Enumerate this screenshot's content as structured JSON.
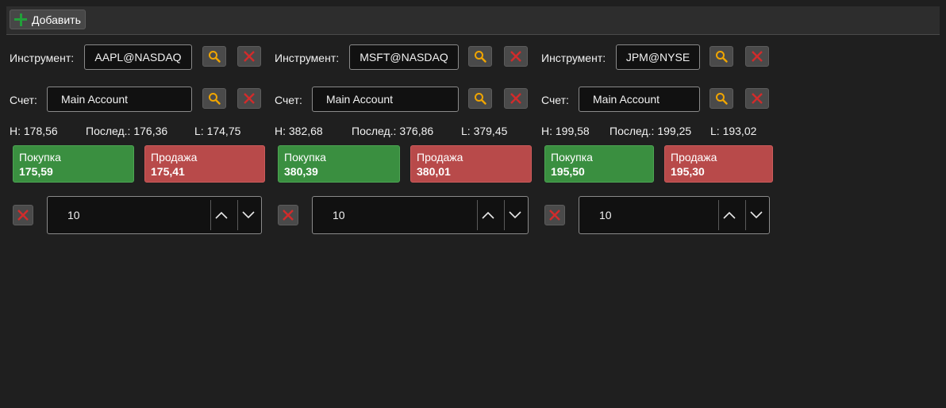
{
  "toolbar": {
    "add_label": "Добавить"
  },
  "colors": {
    "buy": "#3a8f40",
    "sell": "#b84a4a",
    "search_icon": "#f0a500",
    "close_icon": "#d22b2b",
    "add_icon": "#22a03a"
  },
  "panels": [
    {
      "instrument_label": "Инструмент:",
      "instrument": "AAPL@NASDAQ",
      "account_label": "Счет:",
      "account": "Main Account",
      "high": "H: 178,56",
      "last": "Послед.: 176,36",
      "low": "L: 174,75",
      "buy_label": "Покупка",
      "buy_price": "175,59",
      "sell_label": "Продажа",
      "sell_price": "175,41",
      "quantity": "10"
    },
    {
      "instrument_label": "Инструмент:",
      "instrument": "MSFT@NASDAQ",
      "account_label": "Счет:",
      "account": "Main Account",
      "high": "H: 382,68",
      "last": "Послед.: 376,86",
      "low": "L: 379,45",
      "buy_label": "Покупка",
      "buy_price": "380,39",
      "sell_label": "Продажа",
      "sell_price": "380,01",
      "quantity": "10"
    },
    {
      "instrument_label": "Инструмент:",
      "instrument": "JPM@NYSE",
      "account_label": "Счет:",
      "account": "Main Account",
      "high": "H: 199,58",
      "last": "Послед.: 199,25",
      "low": "L: 193,02",
      "buy_label": "Покупка",
      "buy_price": "195,50",
      "sell_label": "Продажа",
      "sell_price": "195,30",
      "quantity": "10"
    }
  ]
}
